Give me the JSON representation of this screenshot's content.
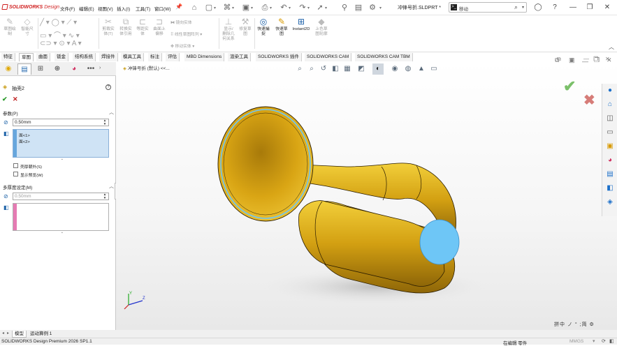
{
  "app": {
    "logo_brand": "SOLIDWORKS",
    "logo_suffix": "Design",
    "document_title": "冲锋号折.SLDPRT *",
    "search_placeholder": "移动"
  },
  "menu": [
    {
      "label": "文件(F)"
    },
    {
      "label": "编辑(E)"
    },
    {
      "label": "视图(V)"
    },
    {
      "label": "插入(I)"
    },
    {
      "label": "工具(T)"
    },
    {
      "label": "窗口(W)"
    }
  ],
  "ribbon": {
    "buttons": [
      {
        "label": "草图绘\n制",
        "icon": "sketch-icon",
        "active": false
      },
      {
        "label": "智能尺\n寸",
        "icon": "smart-dimension-icon",
        "active": false
      },
      {
        "label": "剪裁实\n体(T)",
        "icon": "trim-icon",
        "active": false
      },
      {
        "label": "转换实\n体引用",
        "icon": "convert-icon",
        "active": false
      },
      {
        "label": "等距实\n体",
        "icon": "offset-icon",
        "active": false
      },
      {
        "label": "曲面上\n偏移",
        "icon": "surface-offset-icon",
        "active": false
      },
      {
        "label": "显示/\n删除几\n何关系",
        "icon": "relations-icon",
        "active": false
      },
      {
        "label": "修复草\n图",
        "icon": "repair-sketch-icon",
        "active": false
      },
      {
        "label": "快速捕\n捉",
        "icon": "quick-snap-icon",
        "active": true
      },
      {
        "label": "快速草\n图",
        "icon": "rapid-sketch-icon",
        "active": true
      },
      {
        "label": "Instant2D",
        "icon": "instant2d-icon",
        "active": true
      },
      {
        "label": "上色草\n图轮廓",
        "icon": "shaded-sketch-icon",
        "active": false
      }
    ],
    "small": [
      {
        "label": "镜向实体"
      },
      {
        "label": "线性草图阵列"
      },
      {
        "label": "移动实体"
      }
    ]
  },
  "tabs": [
    {
      "label": "特征",
      "selected": false
    },
    {
      "label": "草图",
      "selected": true
    },
    {
      "label": "曲面",
      "selected": false
    },
    {
      "label": "钣金",
      "selected": false
    },
    {
      "label": "结构系统",
      "selected": false
    },
    {
      "label": "焊接件",
      "selected": false
    },
    {
      "label": "模具工具",
      "selected": false
    },
    {
      "label": "标注",
      "selected": false
    },
    {
      "label": "评估",
      "selected": false
    },
    {
      "label": "MBD Dimensions",
      "selected": false
    },
    {
      "label": "渲染工具",
      "selected": false
    },
    {
      "label": "SOLIDWORKS 插件",
      "selected": false
    },
    {
      "label": "SOLIDWORKS CAM",
      "selected": false
    },
    {
      "label": "SOLIDWORKS CAM TBM",
      "selected": false
    }
  ],
  "feature": {
    "title": "抽壳2",
    "params_header": "参数(P)",
    "thickness": "0.50mm",
    "faces": [
      "面<1>",
      "面<2>"
    ],
    "shell_outward": "壳厚朝外(S)",
    "show_preview": "显示预览(W)",
    "multi_header": "多厚度设定(M)",
    "multi_thickness": "0.50mm"
  },
  "graphics": {
    "breadcrumb": "冲锋号折 (默认) <<..."
  },
  "bottom_tabs": [
    {
      "label": "模型",
      "selected": true
    },
    {
      "label": "运动算例 1",
      "selected": false
    }
  ],
  "status": {
    "product": "SOLIDWORKS Design Premium 2026 SP1.1",
    "editing": "在编辑 零件",
    "units": "MMGS"
  },
  "ime": "拼中 ノ ° ;简 ⚙",
  "colors": {
    "horn_gold": "#d9a514",
    "selected_face": "#6ec6f6",
    "accent_red": "#d02020"
  }
}
